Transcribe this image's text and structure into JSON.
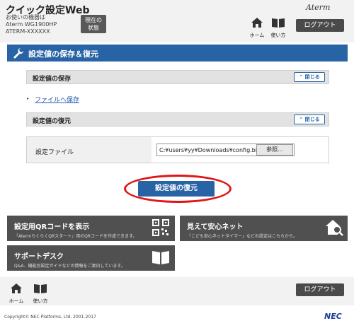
{
  "header": {
    "app_title": "クイック設定Web",
    "device_label": "お使いの機器は",
    "device_model": "Aterm WG1900HP",
    "device_id": "ATERM-XXXXXX",
    "status_button": "現在の\n状態",
    "brand": "Aterm",
    "home_label": "ホーム",
    "help_label": "使い方",
    "logout_label": "ログアウト"
  },
  "page": {
    "section_title": "設定値の保存＆復元",
    "save_panel": {
      "title": "設定値の保存",
      "close_label": "閉じる",
      "link_text": "ファイルへ保存"
    },
    "restore_panel": {
      "title": "設定値の復元",
      "close_label": "閉じる",
      "file_label": "設定ファイル",
      "file_value": "C:¥users¥yy¥Downloads¥config.bin",
      "browse_label": "参照..."
    },
    "restore_button": "設定値の復元"
  },
  "tiles": [
    {
      "title": "設定用QRコードを表示",
      "desc": "「AtermらくらくQRスタート」用のQRコードを作成できます。",
      "icon": "qr-code-icon"
    },
    {
      "title": "見えて安心ネット",
      "desc": "「こども安心ネットタイマー」などの設定はこちらから。",
      "icon": "house-search-icon"
    },
    {
      "title": "サポートデスク",
      "desc": "Q&A、機能別設定ガイドなどの情報をご案内しています。",
      "icon": "book-icon"
    }
  ],
  "footer": {
    "home_label": "ホーム",
    "help_label": "使い方",
    "logout_label": "ログアウト",
    "copyright": "Copyright© NEC Platforms, Ltd. 2001-2017",
    "vendor": "NEC"
  },
  "colors": {
    "accent": "#2863a6",
    "dark_tile": "#505050",
    "highlight": "#e01515",
    "link": "#2255aa"
  }
}
